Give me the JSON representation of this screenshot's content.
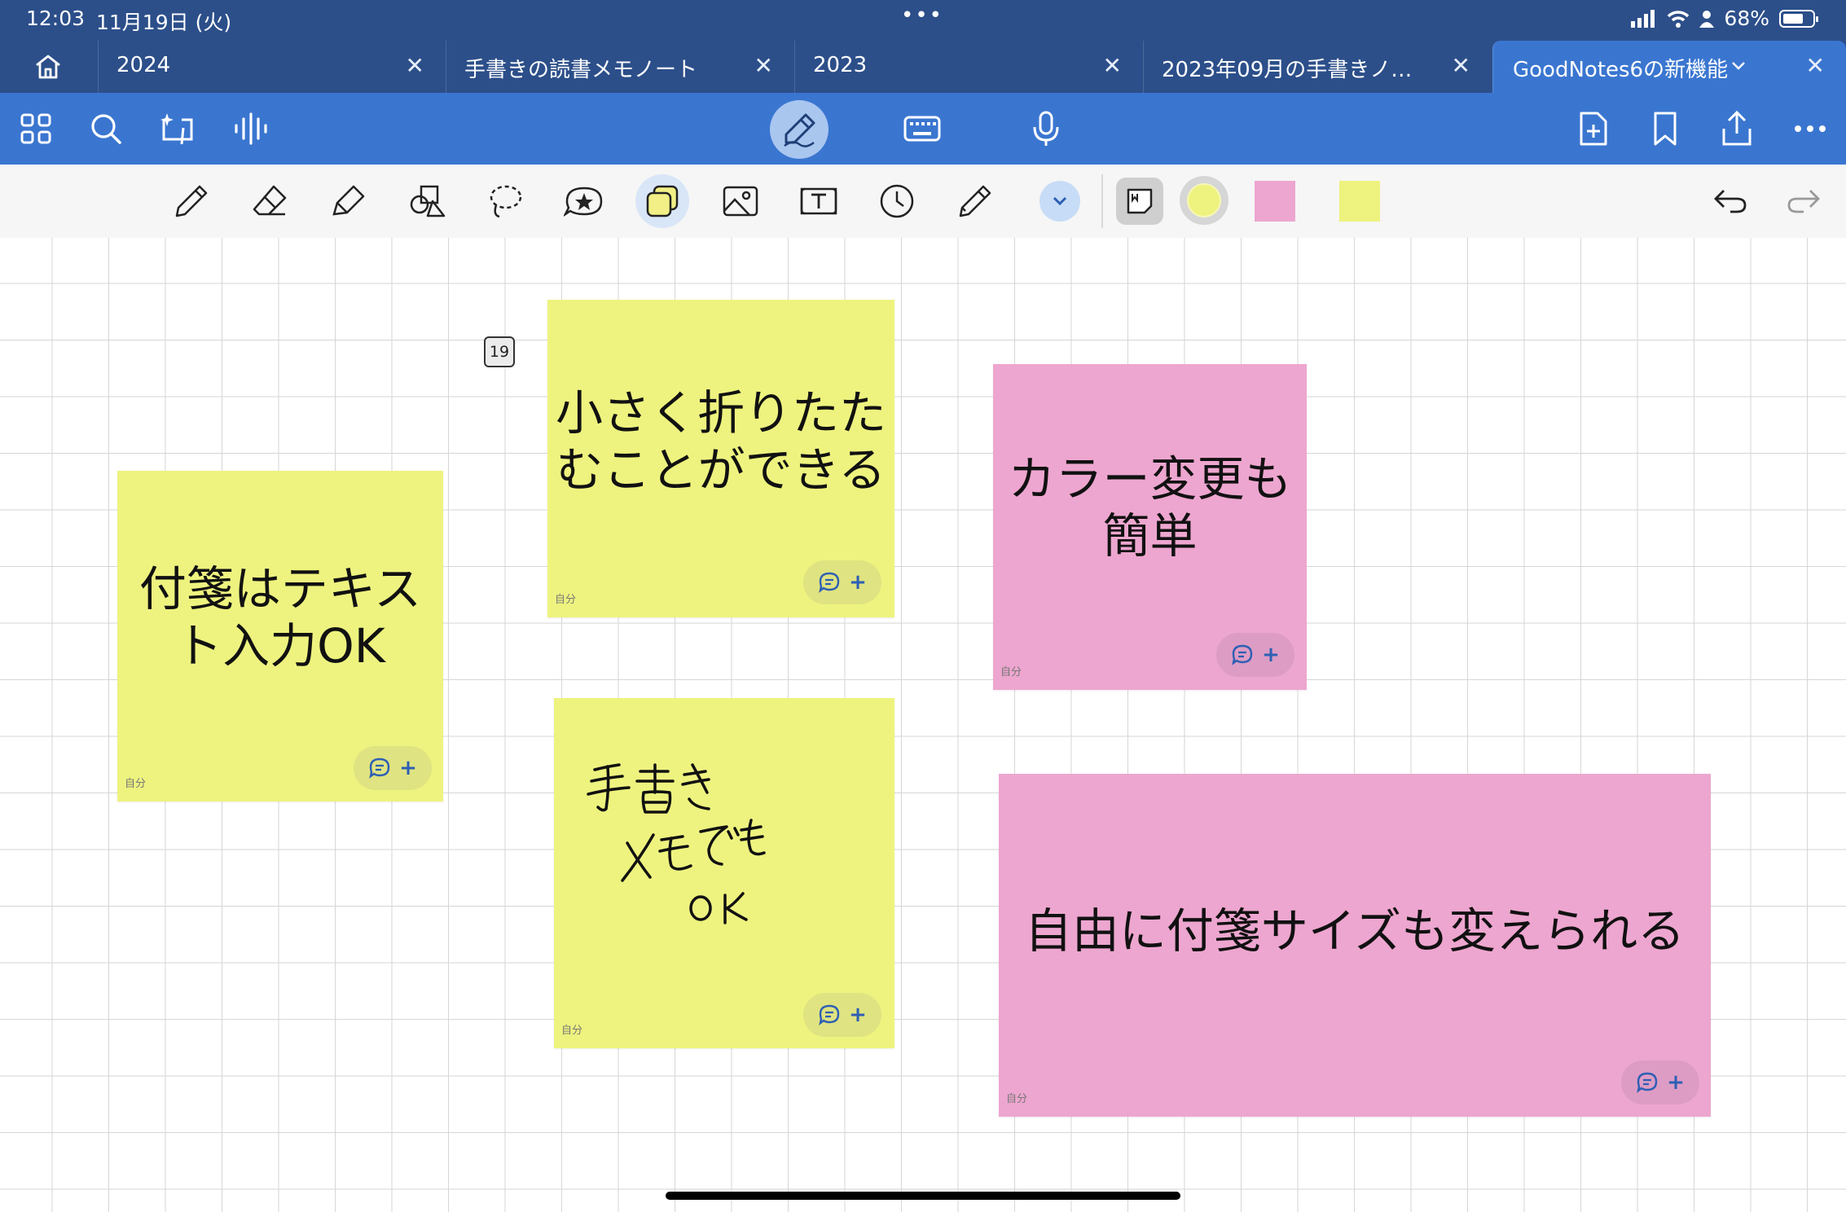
{
  "status_bar": {
    "time": "12:03",
    "date": "11月19日 (火)",
    "dots": "•••",
    "battery_percent": "68%"
  },
  "tabs": [
    {
      "label": "2024"
    },
    {
      "label": "手書きの読書メモノート"
    },
    {
      "label": "2023"
    },
    {
      "label": "2023年09月の手書きノ…"
    },
    {
      "label": "GoodNotes6の新機能",
      "active": true
    }
  ],
  "tab_close_glyph": "✕",
  "canvas": {
    "page_number": "19",
    "notes": [
      {
        "text": "付箋はテキスト入力OK",
        "line1": "付箋はテキス",
        "line2": "ト入力OK",
        "color": "yellow",
        "author": "自分"
      },
      {
        "text": "小さく折りたたむことができる",
        "line1": "小さく折りたた",
        "line2": "むことができる",
        "color": "yellow",
        "author": "自分"
      },
      {
        "text": "カラー変更も簡単",
        "line1": "カラー変更も",
        "line2": "簡単",
        "color": "pink",
        "author": "自分"
      },
      {
        "text": "手書きメモでもOK",
        "handwritten": true,
        "color": "yellow",
        "author": "自分"
      },
      {
        "text": "自由に付箋サイズも変えられる",
        "color": "pink",
        "author": "自分"
      }
    ],
    "comment_plus": "+"
  },
  "colors": {
    "nav_dark": "#2c4f8a",
    "accent_blue": "#3a76d0",
    "note_yellow": "#eef37f",
    "note_pink": "#eda6cf"
  }
}
